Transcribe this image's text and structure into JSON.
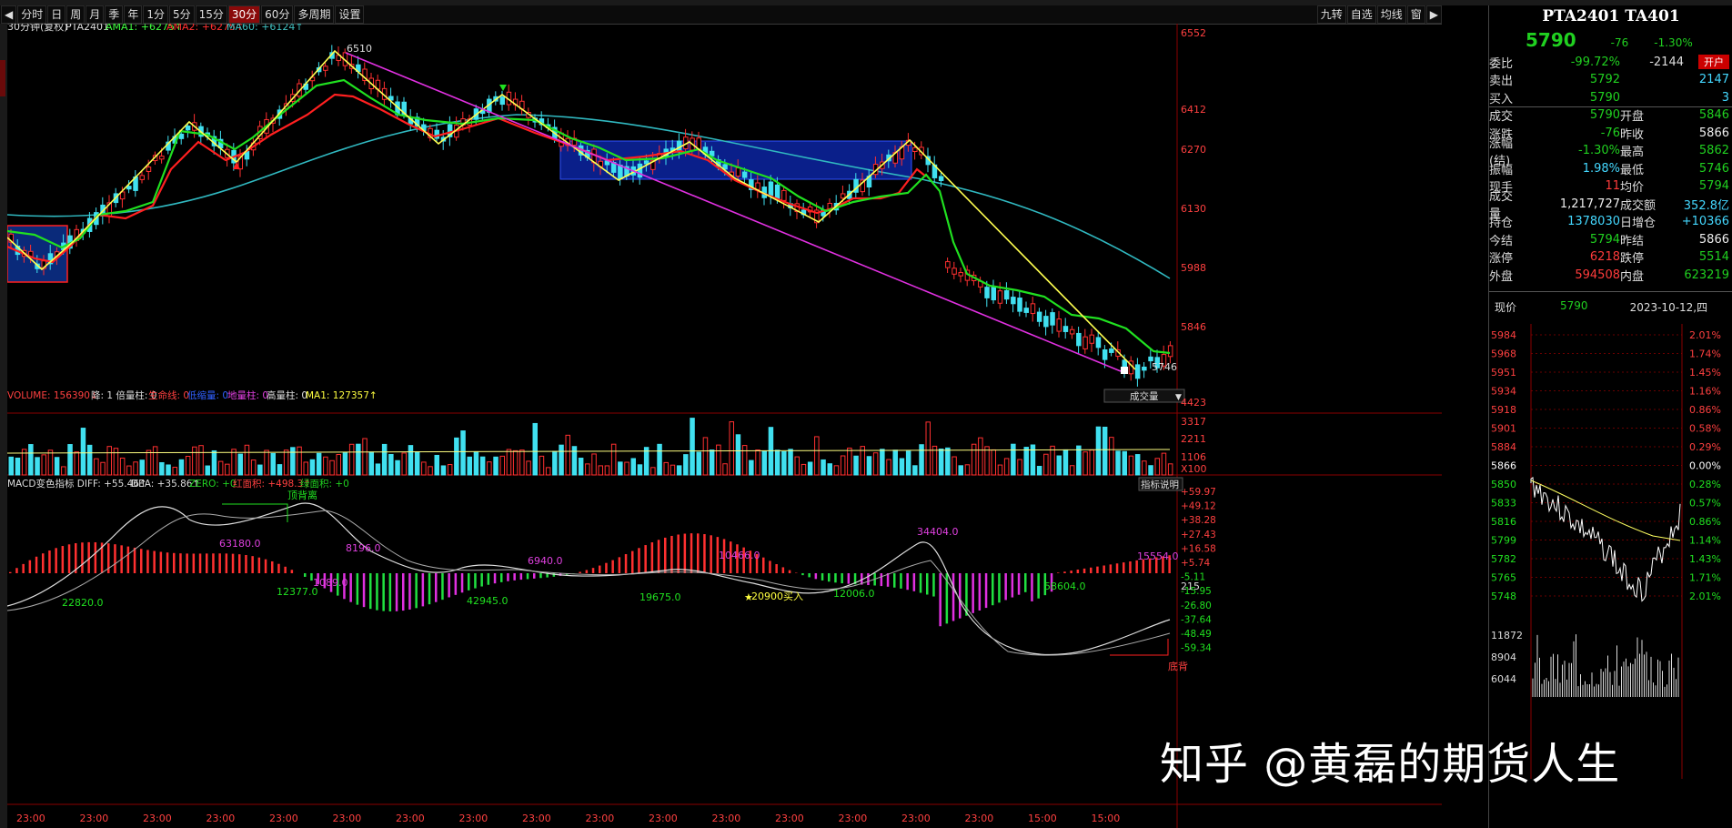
{
  "toolbar": {
    "items": [
      "分时",
      "日",
      "周",
      "月",
      "季",
      "年",
      "1分",
      "5分",
      "15分",
      "30分",
      "60分",
      "多周期",
      "设置"
    ],
    "active_index": 9,
    "right_items": [
      "九转",
      "自选",
      "均线",
      "窗"
    ]
  },
  "legend_main": {
    "period": "30分钟(复权)",
    "symbol": "PTA2401",
    "ama1": "AMA1: +6275↑",
    "ama2": "AMA2: +6275↑",
    "ma60": "MA60: +6124↑"
  },
  "price_axis": [
    "6552",
    "6412",
    "6270",
    "6130",
    "5988",
    "5846"
  ],
  "annotations": {
    "high": "6510",
    "low": "5746"
  },
  "volume_legend": {
    "text1": "VOLUME: 156390↓",
    "text2": "降: 1 倍量柱: 0",
    "text3": "生命线: 0",
    "text4": "低缩量: 0",
    "text5": "地量柱: 0",
    "text6": "高量柱: 0",
    "text7": "MA1: 127357↑",
    "dropdown": "成交量"
  },
  "volume_axis": [
    "4423",
    "3317",
    "2211",
    "1106",
    "X100"
  ],
  "macd_legend": {
    "text1": "MACD变色指标 DIFF: +55.46↑",
    "text2": "DEA: +35.86↑",
    "text3": "ZERO: +0",
    "text4": "红面积: +498.3↑",
    "text5": "绿面积: +0",
    "button": "指标说明"
  },
  "macd_axis": [
    "+59.97",
    "+49.12",
    "+38.28",
    "+27.43",
    "+16.58",
    "+5.74",
    "-5.11",
    "-15.95",
    "-26.80",
    "-37.64",
    "-48.49",
    "-59.34"
  ],
  "macd_labels": {
    "l1": "顶背离",
    "l2": "63180.0",
    "l3": "8196.0",
    "l4": "1089.0",
    "l5": "12377.0",
    "l6": "22820.0",
    "l7": "42945.0",
    "l8": "6940.0",
    "l9": "19675.0",
    "l10": "10466.0",
    "l11": "20900买入",
    "l12": "12006.0",
    "l13": "34404.0",
    "l14": "58604.0",
    "l15": "15554.0",
    "l16": "215",
    "l17": "底背"
  },
  "time_axis": [
    "23:00",
    "23:00",
    "23:00",
    "23:00",
    "23:00",
    "23:00",
    "23:00",
    "23:00",
    "23:00",
    "23:00",
    "23:00",
    "23:00",
    "23:00",
    "23:00",
    "23:00",
    "23:00",
    "15:00",
    "15:00"
  ],
  "side": {
    "title": "PTA2401 TA401",
    "price": "5790",
    "change": "-76",
    "change_pct": "-1.30%",
    "rows": [
      {
        "k": "委比",
        "v": "-99.72%",
        "v_cls": "green",
        "k2": "-2144",
        "v2": "开户",
        "type": "weibi"
      },
      {
        "k": "卖出",
        "v": "5792",
        "v_cls": "green",
        "k2": "",
        "v2": "2147",
        "v2_cls": "cyan"
      },
      {
        "k": "买入",
        "v": "5790",
        "v_cls": "green",
        "k2": "",
        "v2": "3",
        "v2_cls": "cyan"
      },
      {
        "k": "成交",
        "v": "5790",
        "v_cls": "green",
        "k2": "开盘",
        "v2": "5846",
        "v2_cls": "green",
        "sep": true
      },
      {
        "k": "涨跌",
        "v": "-76",
        "v_cls": "green",
        "k2": "昨收",
        "v2": "5866",
        "v2_cls": "white"
      },
      {
        "k": "涨幅(结)",
        "v": "-1.30%",
        "v_cls": "green",
        "k2": "最高",
        "v2": "5862",
        "v2_cls": "green"
      },
      {
        "k": "振幅",
        "v": "1.98%",
        "v_cls": "cyan",
        "k2": "最低",
        "v2": "5746",
        "v2_cls": "green"
      },
      {
        "k": "现手",
        "v": "11",
        "v_cls": "red",
        "k2": "均价",
        "v2": "5794",
        "v2_cls": "green"
      },
      {
        "k": "成交量",
        "v": "1,217,727",
        "v_cls": "white",
        "k2": "成交额",
        "v2": "352.8亿",
        "v2_cls": "cyan"
      },
      {
        "k": "持仓",
        "v": "1378030",
        "v_cls": "cyan",
        "k2": "日增仓",
        "v2": "+10366",
        "v2_cls": "cyan"
      },
      {
        "k": "今结",
        "v": "5794",
        "v_cls": "green",
        "k2": "昨结",
        "v2": "5866",
        "v2_cls": "white"
      },
      {
        "k": "涨停",
        "v": "6218",
        "v_cls": "red",
        "k2": "跌停",
        "v2": "5514",
        "v2_cls": "green"
      },
      {
        "k": "外盘",
        "v": "594508",
        "v_cls": "red",
        "k2": "内盘",
        "v2": "623219",
        "v2_cls": "green"
      }
    ],
    "xianjia_label": "现价",
    "xianjia_value": "5790",
    "date": "2023-10-12,四",
    "mini_left_axis": [
      "5984",
      "5968",
      "5951",
      "5934",
      "5918",
      "5901",
      "5884",
      "5866",
      "5850",
      "5833",
      "5816",
      "5799",
      "5782",
      "5765",
      "5748"
    ],
    "mini_right_axis": [
      "2.01%",
      "1.74%",
      "1.45%",
      "1.16%",
      "0.86%",
      "0.58%",
      "0.29%",
      "0.00%",
      "0.28%",
      "0.57%",
      "0.86%",
      "1.14%",
      "1.43%",
      "1.71%",
      "2.01%"
    ],
    "mini_vol_axis": [
      "11872",
      "8904",
      "6044"
    ]
  },
  "watermark": "知乎 @黄磊的期货人生"
}
